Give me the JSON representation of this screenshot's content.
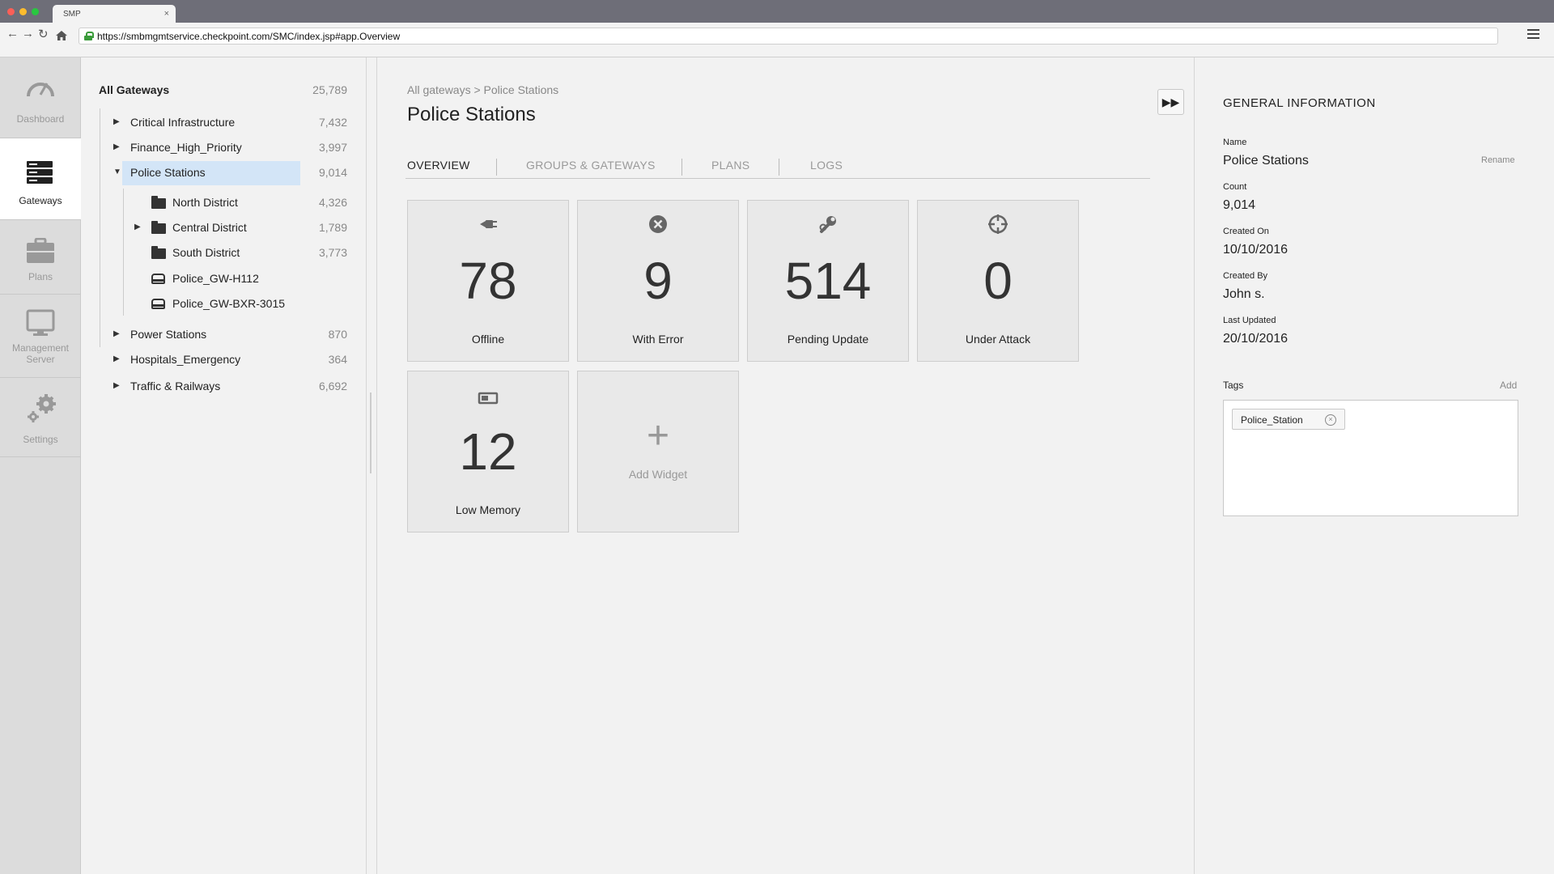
{
  "browser": {
    "tab_title": "SMP",
    "tab_close": "×",
    "url": "https://smbmgmtservice.checkpoint.com/SMC/index.jsp#app.Overview"
  },
  "leftnav": {
    "items": [
      {
        "label": "Dashboard",
        "icon": "speedometer-icon"
      },
      {
        "label": "Gateways",
        "icon": "gateways-icon"
      },
      {
        "label": "Plans",
        "icon": "briefcase-icon"
      },
      {
        "label": "Management Server",
        "label_line1": "Management",
        "label_line2": "Server",
        "icon": "monitor-icon"
      },
      {
        "label": "Settings",
        "icon": "gears-icon"
      }
    ]
  },
  "tree": {
    "root": {
      "label": "All Gateways",
      "count": "25,789"
    },
    "groups": [
      {
        "label": "Critical Infrastructure",
        "count": "7,432"
      },
      {
        "label": "Finance_High_Priority",
        "count": "3,997"
      },
      {
        "label": "Police Stations",
        "count": "9,014"
      },
      {
        "label": "Power Stations",
        "count": "870"
      },
      {
        "label": "Hospitals_Emergency",
        "count": "364"
      },
      {
        "label": "Traffic & Railways",
        "count": "6,692"
      }
    ],
    "children": [
      {
        "label": "North District",
        "count": "4,326"
      },
      {
        "label": "Central District",
        "count": "1,789"
      },
      {
        "label": "South District",
        "count": "3,773"
      },
      {
        "label": "Police_GW-H112",
        "count": ""
      },
      {
        "label": "Police_GW-BXR-3015",
        "count": ""
      }
    ],
    "arrows": {
      "collapsed": "▶",
      "expanded": "▼"
    }
  },
  "main": {
    "breadcrumb": "All gateways > Police Stations",
    "title": "Police Stations",
    "expand_label": "▶▶",
    "tabs": [
      "OVERVIEW",
      "GROUPS & GATEWAYS",
      "PLANS",
      "LOGS"
    ],
    "widgets": [
      {
        "value": "78",
        "label": "Offline",
        "icon": "unplugged-icon"
      },
      {
        "value": "9",
        "label": "With Error",
        "icon": "error-circle-icon"
      },
      {
        "value": "514",
        "label": "Pending Update",
        "icon": "wrench-icon"
      },
      {
        "value": "0",
        "label": "Under Attack",
        "icon": "crosshair-icon"
      },
      {
        "value": "12",
        "label": "Low Memory",
        "icon": "memory-icon"
      }
    ],
    "add_widget": {
      "plus": "+",
      "label": "Add Widget"
    }
  },
  "general_info": {
    "heading": "GENERAL INFORMATION",
    "rename": "Rename",
    "fields": [
      {
        "label": "Name",
        "value": "Police Stations"
      },
      {
        "label": "Count",
        "value": "9,014"
      },
      {
        "label": "Created On",
        "value": "10/10/2016"
      },
      {
        "label": "Created By",
        "value": "John s."
      },
      {
        "label": "Last Updated",
        "value": "20/10/2016"
      }
    ],
    "tags_label": "Tags",
    "tags_add": "Add",
    "tags": [
      {
        "label": "Police_Station",
        "remove": "×"
      }
    ]
  },
  "colors": {
    "selected_row": "#d3e5f7",
    "secure_lock": "#3a9b3a",
    "nav_bg": "#dcdcdc"
  }
}
